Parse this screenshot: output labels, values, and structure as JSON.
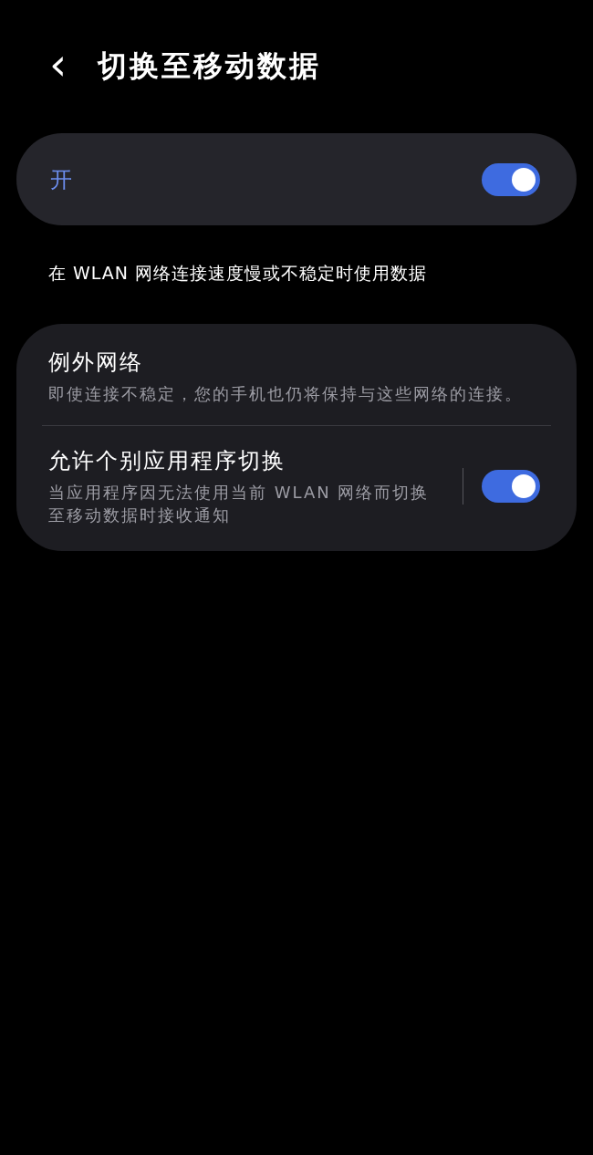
{
  "header": {
    "back": "‹",
    "title": "切换至移动数据"
  },
  "master": {
    "label": "开",
    "on": true
  },
  "description": "在 WLAN 网络连接速度慢或不稳定时使用数据",
  "items": [
    {
      "kind": "link",
      "title": "例外网络",
      "subtitle": "即使连接不稳定，您的手机也仍将保持与这些网络的连接。"
    },
    {
      "kind": "toggle",
      "title": "允许个别应用程序切换",
      "subtitle": "当应用程序因无法使用当前 WLAN 网络而切换至移动数据时接收通知",
      "on": true
    }
  ]
}
